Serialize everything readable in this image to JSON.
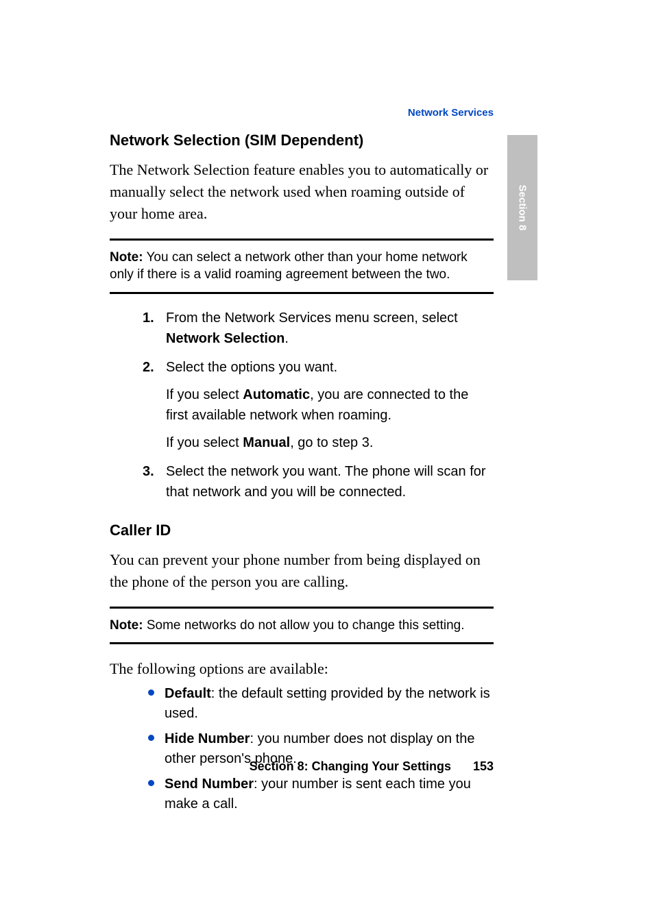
{
  "header": {
    "running_title": "Network Services"
  },
  "sideTab": {
    "label": "Section 8"
  },
  "sections": {
    "networkSelection": {
      "title": "Network Selection (SIM Dependent)",
      "intro": "The Network Selection feature enables you to automatically or manually select the network used when roaming outside of your home area.",
      "note": {
        "label": "Note:",
        "text": " You can select a network other than your home network only if there is a valid roaming agreement between the two."
      },
      "steps": [
        {
          "num": "1.",
          "text_before": "From the Network Services menu screen, select ",
          "bold": "Network Selection",
          "text_after": "."
        },
        {
          "num": "2.",
          "text": "Select the options you want.",
          "sub1_before": "If you select ",
          "sub1_bold": "Automatic",
          "sub1_after": ", you are connected to the first available network when roaming.",
          "sub2_before": "If you select ",
          "sub2_bold": "Manual",
          "sub2_after": ", go to step 3."
        },
        {
          "num": "3.",
          "text": "Select the network you want. The phone will scan for that network and you will be connected."
        }
      ]
    },
    "callerId": {
      "title": "Caller ID",
      "intro": "You can prevent your phone number from being displayed on the phone of the person you are calling.",
      "note": {
        "label": "Note:",
        "text": " Some networks do not allow you to change this setting."
      },
      "optionsIntro": "The following options are available:",
      "bullets": [
        {
          "bold": "Default",
          "text": ": the default setting provided by the network is used."
        },
        {
          "bold": "Hide Number",
          "text": ": you number does not display on the other person's phone."
        },
        {
          "bold": "Send Number",
          "text": ": your number is sent each time you make a call."
        }
      ]
    }
  },
  "footer": {
    "section": "Section 8: Changing Your Settings",
    "page": "153"
  }
}
